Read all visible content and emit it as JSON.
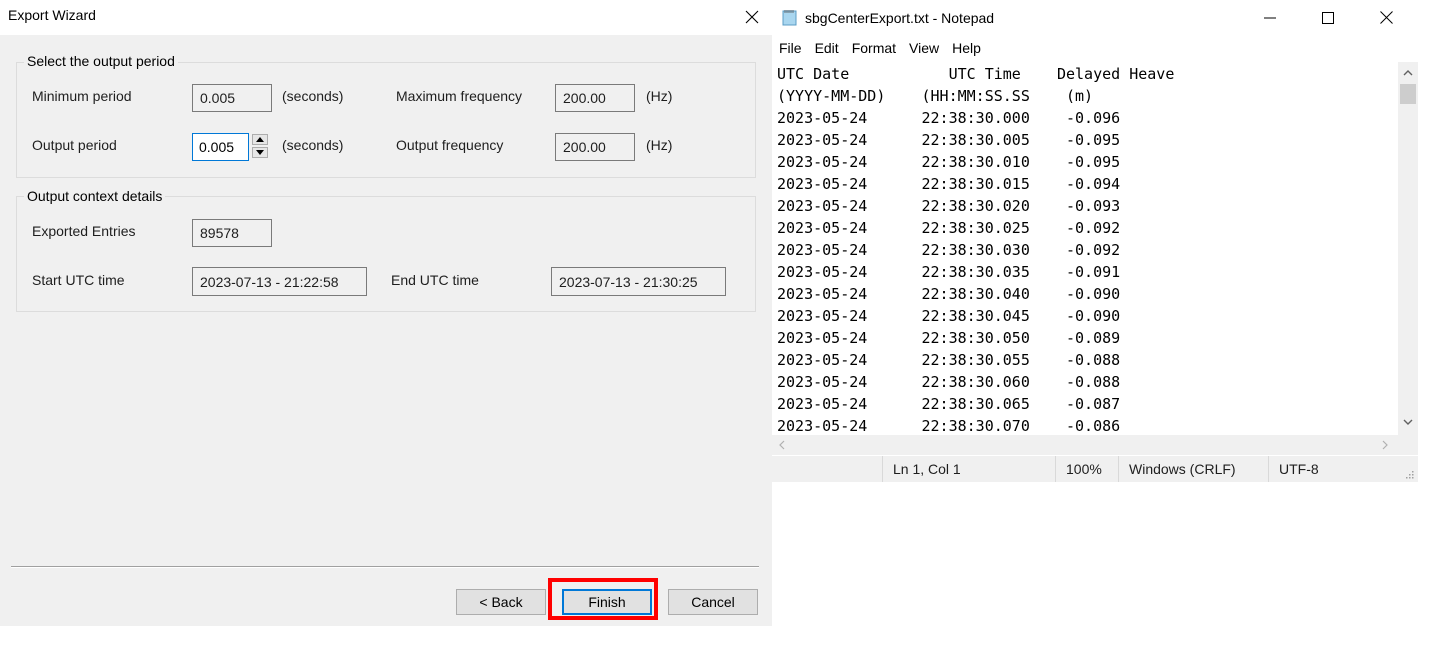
{
  "wizard": {
    "title": "Export Wizard",
    "close_icon": "close-icon",
    "period_group": {
      "legend": "Select the output period",
      "min_period_label": "Minimum period",
      "min_period_value": "0.005",
      "min_period_unit": "(seconds)",
      "max_freq_label": "Maximum frequency",
      "max_freq_value": "200.00",
      "max_freq_unit": "(Hz)",
      "output_period_label": "Output period",
      "output_period_value": "0.005",
      "output_period_unit": "(seconds)",
      "output_freq_label": "Output frequency",
      "output_freq_value": "200.00",
      "output_freq_unit": "(Hz)"
    },
    "context_group": {
      "legend": "Output context details",
      "exported_entries_label": "Exported Entries",
      "exported_entries_value": "89578",
      "start_label": "Start UTC time",
      "start_value": "2023-07-13 - 21:22:58",
      "end_label": "End UTC time",
      "end_value": "2023-07-13 - 21:30:25"
    },
    "buttons": {
      "back": "< Back",
      "finish": "Finish",
      "cancel": "Cancel"
    },
    "highlight_color": "#ff0000",
    "accent_color": "#0078d7"
  },
  "notepad": {
    "title": "sbgCenterExport.txt - Notepad",
    "menu": [
      "File",
      "Edit",
      "Format",
      "View",
      "Help"
    ],
    "header_lines": [
      "UTC Date           UTC Time    Delayed Heave",
      "(YYYY-MM-DD)    (HH:MM:SS.SS    (m)"
    ],
    "rows": [
      {
        "date": "2023-05-24",
        "time": "22:38:30.000",
        "heave": "-0.096"
      },
      {
        "date": "2023-05-24",
        "time": "22:38:30.005",
        "heave": "-0.095"
      },
      {
        "date": "2023-05-24",
        "time": "22:38:30.010",
        "heave": "-0.095"
      },
      {
        "date": "2023-05-24",
        "time": "22:38:30.015",
        "heave": "-0.094"
      },
      {
        "date": "2023-05-24",
        "time": "22:38:30.020",
        "heave": "-0.093"
      },
      {
        "date": "2023-05-24",
        "time": "22:38:30.025",
        "heave": "-0.092"
      },
      {
        "date": "2023-05-24",
        "time": "22:38:30.030",
        "heave": "-0.092"
      },
      {
        "date": "2023-05-24",
        "time": "22:38:30.035",
        "heave": "-0.091"
      },
      {
        "date": "2023-05-24",
        "time": "22:38:30.040",
        "heave": "-0.090"
      },
      {
        "date": "2023-05-24",
        "time": "22:38:30.045",
        "heave": "-0.090"
      },
      {
        "date": "2023-05-24",
        "time": "22:38:30.050",
        "heave": "-0.089"
      },
      {
        "date": "2023-05-24",
        "time": "22:38:30.055",
        "heave": "-0.088"
      },
      {
        "date": "2023-05-24",
        "time": "22:38:30.060",
        "heave": "-0.088"
      },
      {
        "date": "2023-05-24",
        "time": "22:38:30.065",
        "heave": "-0.087"
      },
      {
        "date": "2023-05-24",
        "time": "22:38:30.070",
        "heave": "-0.086"
      }
    ],
    "status": {
      "position": "Ln 1, Col 1",
      "zoom": "100%",
      "line_ending": "Windows (CRLF)",
      "encoding": "UTF-8"
    }
  }
}
